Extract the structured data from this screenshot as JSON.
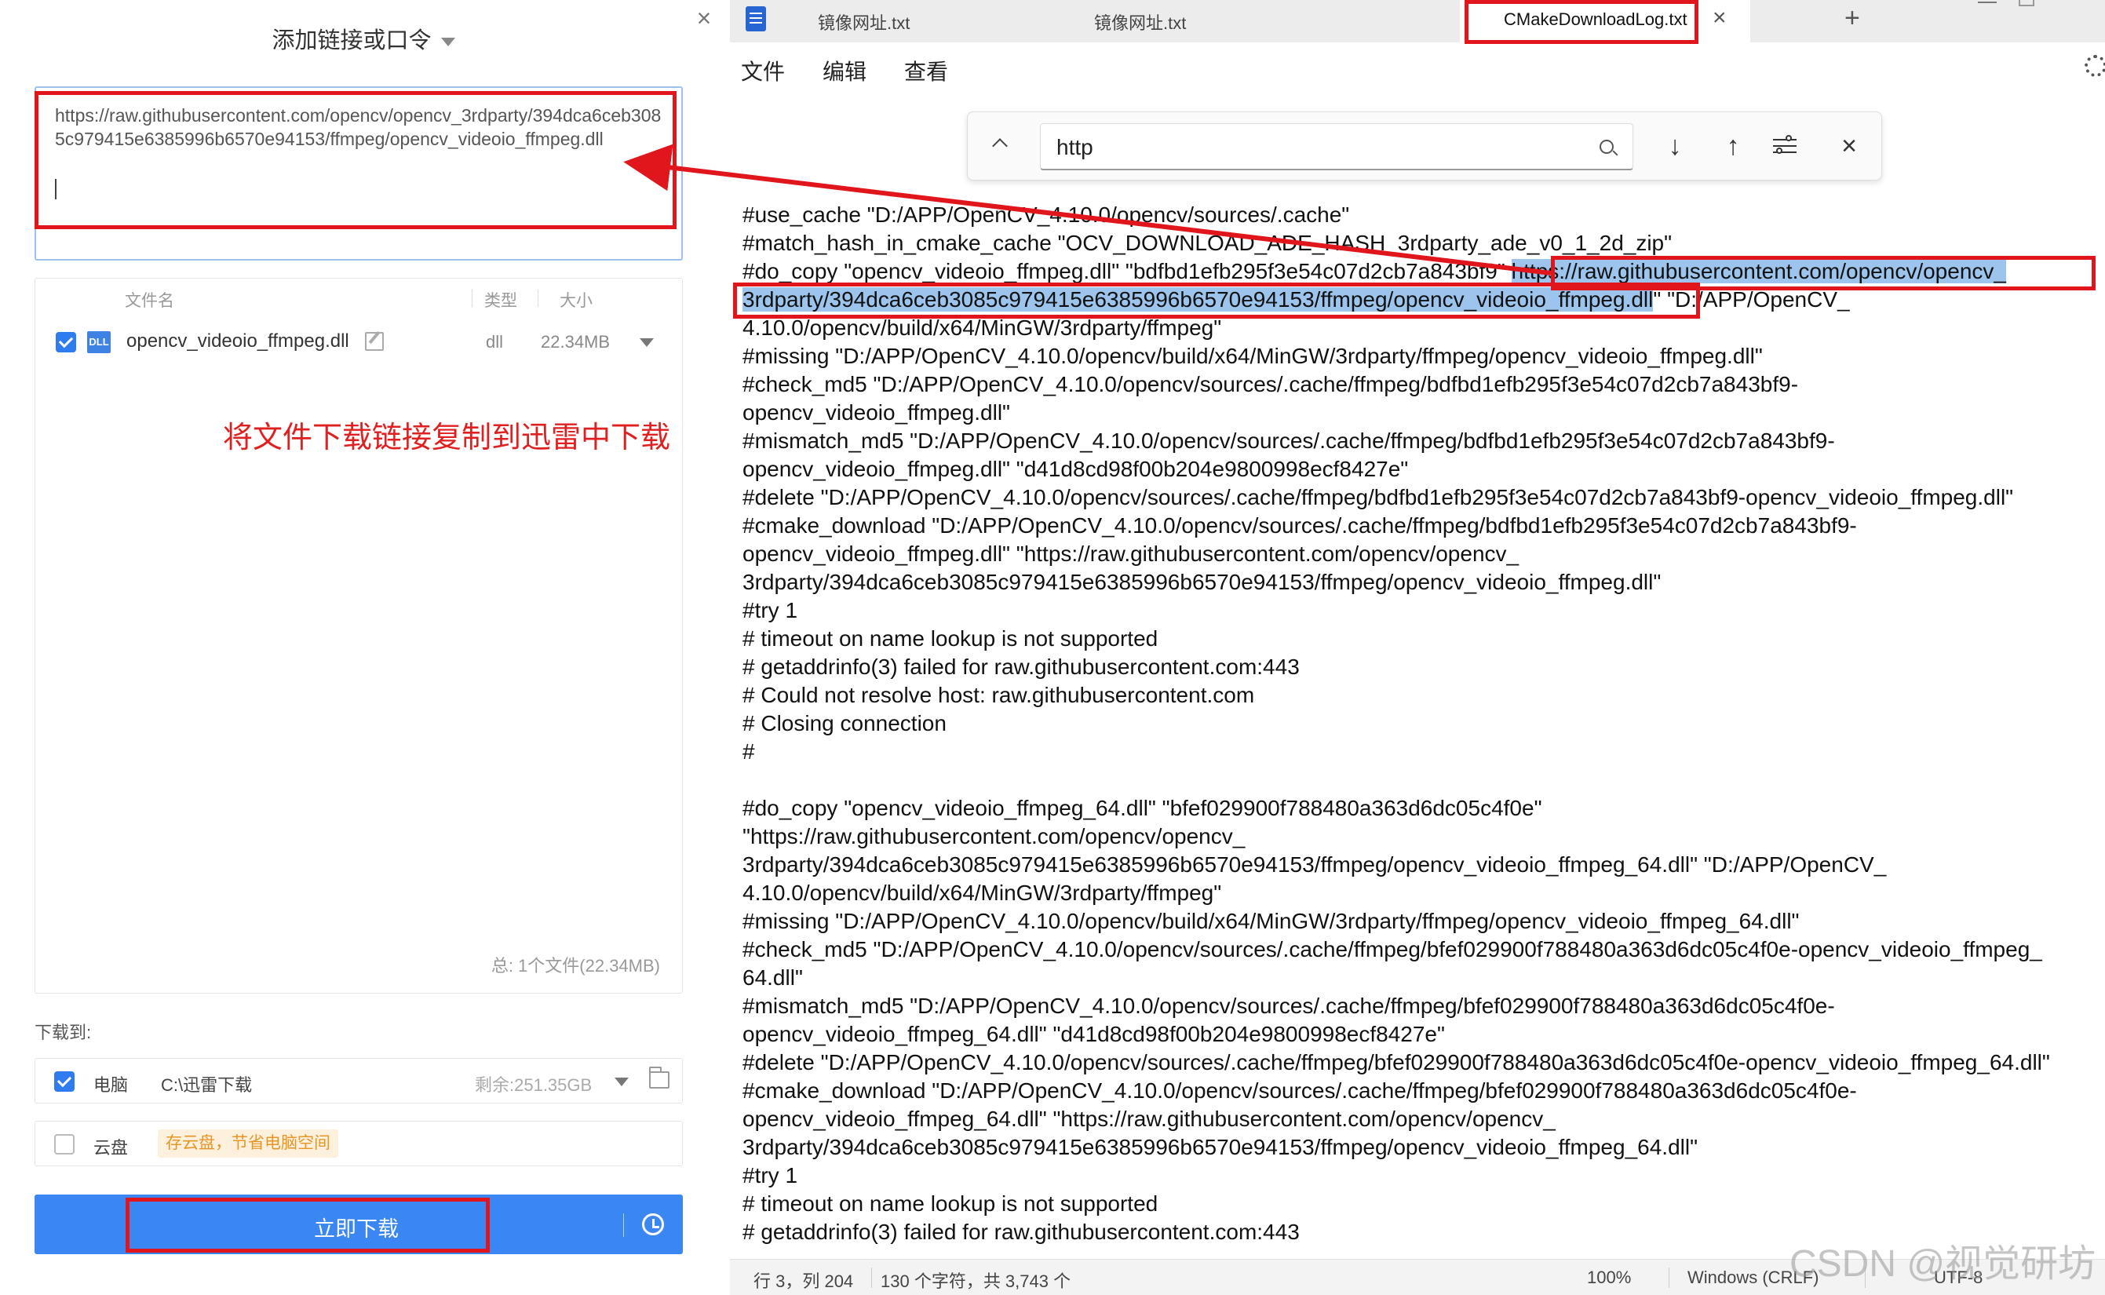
{
  "dialog": {
    "title": "添加链接或口令",
    "close": "×",
    "url_text": "https://raw.githubusercontent.com/opencv/opencv_3rdparty/394dca6ceb3085c979415e6385996b6570e94153/ffmpeg/opencv_videoio_ffmpeg.dll",
    "headers": {
      "name": "文件名",
      "type": "类型",
      "size": "大小"
    },
    "file": {
      "icon": "DLL",
      "name": "opencv_videoio_ffmpeg.dll",
      "type": "dll",
      "size": "22.34MB"
    },
    "total": "总:   1个文件(22.34MB)",
    "annotation": "将文件下载链接复制到迅雷中下载",
    "save_to_label": "下载到:",
    "local": {
      "name": "电脑",
      "path": "C:\\迅雷下载",
      "free": "剩余:251.35GB"
    },
    "cloud": {
      "name": "云盘",
      "tag": "存云盘，节省电脑空间"
    },
    "download_button": "立即下载"
  },
  "notepad": {
    "tabs": [
      {
        "label": "镜像网址.txt"
      },
      {
        "label": "镜像网址.txt"
      },
      {
        "label": "CMakeDownloadLog.txt"
      }
    ],
    "tab_close": "×",
    "tab_add": "+",
    "menu": {
      "file": "文件",
      "edit": "编辑",
      "view": "查看"
    },
    "find": {
      "query": "http",
      "down": "↓",
      "up": "↑",
      "close": "×"
    },
    "lines": [
      {
        "text": "#use_cache \"D:/APP/OpenCV_4.10.0/opencv/sources/.cache\""
      },
      {
        "text": "#match_hash_in_cmake_cache \"OCV_DOWNLOAD_ADE_HASH_3rdparty_ade_v0_1_2d_zip\""
      },
      {
        "text": "#do_copy \"opencv_videoio_ffmpeg.dll\" \"bdfbd1efb295f3e54c07d2cb7a843bf9\" ",
        "hl": "https://raw.githubusercontent.com/opencv/opencv_"
      },
      {
        "pre": "",
        "hl": "3rdparty/394dca6ceb3085c979415e6385996b6570e94153/ffmpeg/opencv_videoio_ffmpeg.dll",
        "post": "\" \"D:/APP/OpenCV_"
      },
      {
        "text": "4.10.0/opencv/build/x64/MinGW/3rdparty/ffmpeg\""
      },
      {
        "text": "#missing \"D:/APP/OpenCV_4.10.0/opencv/build/x64/MinGW/3rdparty/ffmpeg/opencv_videoio_ffmpeg.dll\""
      },
      {
        "text": "#check_md5 \"D:/APP/OpenCV_4.10.0/opencv/sources/.cache/ffmpeg/bdfbd1efb295f3e54c07d2cb7a843bf9-"
      },
      {
        "text": "opencv_videoio_ffmpeg.dll\""
      },
      {
        "text": "#mismatch_md5 \"D:/APP/OpenCV_4.10.0/opencv/sources/.cache/ffmpeg/bdfbd1efb295f3e54c07d2cb7a843bf9-"
      },
      {
        "text": "opencv_videoio_ffmpeg.dll\" \"d41d8cd98f00b204e9800998ecf8427e\""
      },
      {
        "text": "#delete \"D:/APP/OpenCV_4.10.0/opencv/sources/.cache/ffmpeg/bdfbd1efb295f3e54c07d2cb7a843bf9-opencv_videoio_ffmpeg.dll\""
      },
      {
        "text": "#cmake_download \"D:/APP/OpenCV_4.10.0/opencv/sources/.cache/ffmpeg/bdfbd1efb295f3e54c07d2cb7a843bf9-"
      },
      {
        "text": "opencv_videoio_ffmpeg.dll\" \"https://raw.githubusercontent.com/opencv/opencv_"
      },
      {
        "text": "3rdparty/394dca6ceb3085c979415e6385996b6570e94153/ffmpeg/opencv_videoio_ffmpeg.dll\""
      },
      {
        "text": "#try 1"
      },
      {
        "text": "# timeout on name lookup is not supported"
      },
      {
        "text": "# getaddrinfo(3) failed for raw.githubusercontent.com:443"
      },
      {
        "text": "# Could not resolve host: raw.githubusercontent.com"
      },
      {
        "text": "# Closing connection"
      },
      {
        "text": "#"
      },
      {
        "text": ""
      },
      {
        "text": "#do_copy \"opencv_videoio_ffmpeg_64.dll\" \"bfef029900f788480a363d6dc05c4f0e\""
      },
      {
        "text": "\"https://raw.githubusercontent.com/opencv/opencv_"
      },
      {
        "text": "3rdparty/394dca6ceb3085c979415e6385996b6570e94153/ffmpeg/opencv_videoio_ffmpeg_64.dll\" \"D:/APP/OpenCV_"
      },
      {
        "text": "4.10.0/opencv/build/x64/MinGW/3rdparty/ffmpeg\""
      },
      {
        "text": "#missing \"D:/APP/OpenCV_4.10.0/opencv/build/x64/MinGW/3rdparty/ffmpeg/opencv_videoio_ffmpeg_64.dll\""
      },
      {
        "text": "#check_md5 \"D:/APP/OpenCV_4.10.0/opencv/sources/.cache/ffmpeg/bfef029900f788480a363d6dc05c4f0e-opencv_videoio_ffmpeg_"
      },
      {
        "text": "64.dll\""
      },
      {
        "text": "#mismatch_md5 \"D:/APP/OpenCV_4.10.0/opencv/sources/.cache/ffmpeg/bfef029900f788480a363d6dc05c4f0e-"
      },
      {
        "text": "opencv_videoio_ffmpeg_64.dll\" \"d41d8cd98f00b204e9800998ecf8427e\""
      },
      {
        "text": "#delete \"D:/APP/OpenCV_4.10.0/opencv/sources/.cache/ffmpeg/bfef029900f788480a363d6dc05c4f0e-opencv_videoio_ffmpeg_64.dll\""
      },
      {
        "text": "#cmake_download \"D:/APP/OpenCV_4.10.0/opencv/sources/.cache/ffmpeg/bfef029900f788480a363d6dc05c4f0e-"
      },
      {
        "text": "opencv_videoio_ffmpeg_64.dll\" \"https://raw.githubusercontent.com/opencv/opencv_"
      },
      {
        "text": "3rdparty/394dca6ceb3085c979415e6385996b6570e94153/ffmpeg/opencv_videoio_ffmpeg_64.dll\""
      },
      {
        "text": "#try 1"
      },
      {
        "text": "# timeout on name lookup is not supported"
      },
      {
        "text": "# getaddrinfo(3) failed for raw.githubusercontent.com:443"
      }
    ],
    "status": {
      "position": "行 3，列 204",
      "chars": "130 个字符，共 3,743 个",
      "zoom": "100%",
      "line_ending": "Windows (CRLF)",
      "encoding": "UTF-8"
    }
  },
  "watermark": "CSDN @视觉研坊",
  "colors": {
    "accent_blue": "#3a86f2",
    "annotation_red": "#e0161c",
    "selection": "#9dc4ec"
  }
}
